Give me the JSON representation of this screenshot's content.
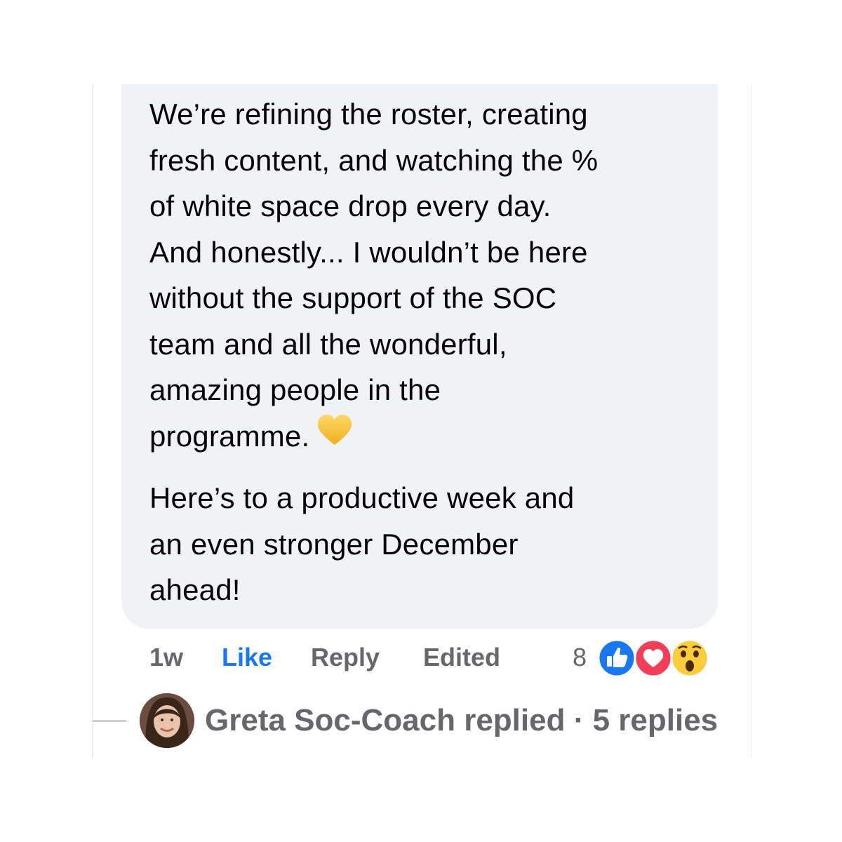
{
  "comment": {
    "paragraph1": [
      "We’re refining the roster, creating",
      "fresh content, and watching the %",
      "of white space drop every day.",
      "And honestly... I wouldn’t be here",
      "without the support of the SOC",
      "team and all the wonderful,",
      "amazing people in the",
      "programme."
    ],
    "paragraph2": [
      "Here’s to a productive week and",
      "an even stronger December",
      "ahead!"
    ],
    "emoji": "yellow-heart-icon"
  },
  "actions": {
    "time": "1w",
    "like_label": "Like",
    "reply_label": "Reply",
    "edited_label": "Edited",
    "reaction_count": "8",
    "reactions": [
      "like-reaction-icon",
      "love-reaction-icon",
      "wow-reaction-icon"
    ]
  },
  "replies": {
    "summary": "Greta Soc-Coach replied · 5 replies"
  },
  "colors": {
    "bubble": "#f0f2f5",
    "text": "#050505",
    "muted": "#65676b",
    "link": "#1877f2",
    "like_blue": "#1877f2",
    "love_red": "#f33e58",
    "wow_yellow": "#f7b125"
  }
}
